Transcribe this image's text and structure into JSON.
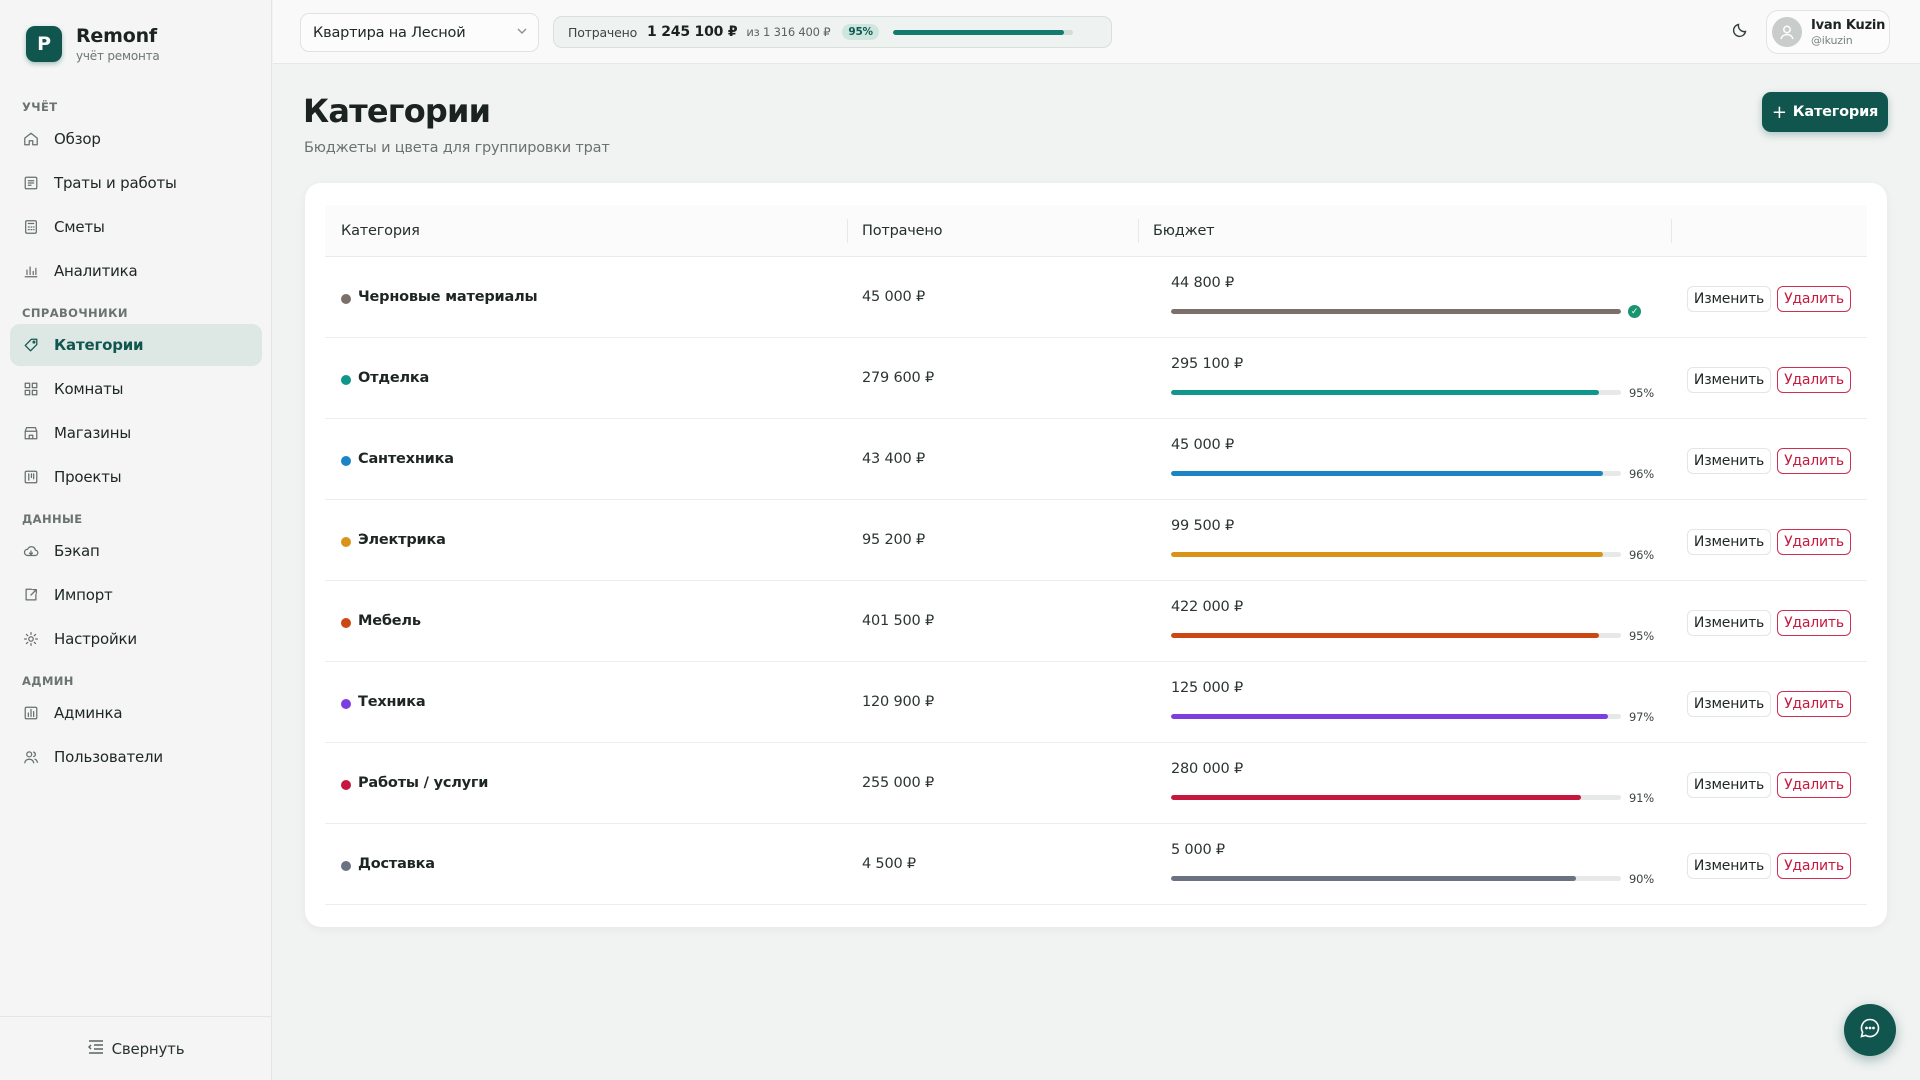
{
  "brand": {
    "logo_letter": "P",
    "name": "Remonf",
    "subtitle": "учёт ремонта"
  },
  "sidebar": {
    "sections": [
      {
        "title": "УЧЁТ",
        "items": [
          {
            "label": "Обзор",
            "icon": "home-icon"
          },
          {
            "label": "Траты и работы",
            "icon": "receipt-icon"
          },
          {
            "label": "Сметы",
            "icon": "calculator-icon"
          },
          {
            "label": "Аналитика",
            "icon": "bar-chart-icon"
          }
        ]
      },
      {
        "title": "СПРАВОЧНИКИ",
        "items": [
          {
            "label": "Категории",
            "icon": "tag-icon",
            "active": true
          },
          {
            "label": "Комнаты",
            "icon": "grid-icon"
          },
          {
            "label": "Магазины",
            "icon": "store-icon"
          },
          {
            "label": "Проекты",
            "icon": "board-icon"
          }
        ]
      },
      {
        "title": "ДАННЫЕ",
        "items": [
          {
            "label": "Бэкап",
            "icon": "cloud-icon"
          },
          {
            "label": "Импорт",
            "icon": "import-icon"
          },
          {
            "label": "Настройки",
            "icon": "gear-icon"
          }
        ]
      },
      {
        "title": "АДМИН",
        "items": [
          {
            "label": "Админка",
            "icon": "admin-panel-icon"
          },
          {
            "label": "Пользователи",
            "icon": "users-icon"
          }
        ]
      }
    ],
    "collapse_label": "Свернуть"
  },
  "topbar": {
    "project": "Квартира на Лесной",
    "spend": {
      "label": "Потрачено",
      "amount": "1 245 100 ₽",
      "of": "из 1 316 400 ₽",
      "percent_label": "95%",
      "progress": 0.95
    },
    "user": {
      "name": "Ivan Kuzin",
      "handle": "@ikuzin"
    }
  },
  "page": {
    "title": "Категории",
    "subtitle": "Бюджеты и цвета для группировки трат",
    "add_button": "Категория"
  },
  "table": {
    "headers": {
      "name": "Категория",
      "spent": "Потрачено",
      "budget": "Бюджет"
    },
    "edit_label": "Изменить",
    "delete_label": "Удалить",
    "rows": [
      {
        "name": "Черновые материалы",
        "spent": "45 000 ₽",
        "budget": "44 800 ₽",
        "progress": 1.0,
        "pct": "",
        "over": true,
        "color": "#7b6f69"
      },
      {
        "name": "Отделка",
        "spent": "279 600 ₽",
        "budget": "295 100 ₽",
        "progress": 0.95,
        "pct": "95%",
        "over": false,
        "color": "#10968a"
      },
      {
        "name": "Сантехника",
        "spent": "43 400 ₽",
        "budget": "45 000 ₽",
        "progress": 0.96,
        "pct": "96%",
        "over": false,
        "color": "#1a84c7"
      },
      {
        "name": "Электрика",
        "spent": "95 200 ₽",
        "budget": "99 500 ₽",
        "progress": 0.96,
        "pct": "96%",
        "over": false,
        "color": "#d99418"
      },
      {
        "name": "Мебель",
        "spent": "401 500 ₽",
        "budget": "422 000 ₽",
        "progress": 0.95,
        "pct": "95%",
        "over": false,
        "color": "#cc4712"
      },
      {
        "name": "Техника",
        "spent": "120 900 ₽",
        "budget": "125 000 ₽",
        "progress": 0.97,
        "pct": "97%",
        "over": false,
        "color": "#7d3ee0"
      },
      {
        "name": "Работы / услуги",
        "spent": "255 000 ₽",
        "budget": "280 000 ₽",
        "progress": 0.91,
        "pct": "91%",
        "over": false,
        "color": "#c4183f"
      },
      {
        "name": "Доставка",
        "spent": "4 500 ₽",
        "budget": "5 000 ₽",
        "progress": 0.9,
        "pct": "90%",
        "over": false,
        "color": "#6b7382"
      }
    ]
  },
  "colors": {
    "accent": "#10564e",
    "danger": "#c5193e",
    "active_nav_bg": "#dde7e4"
  },
  "icons": {
    "theme": "moon-icon",
    "chat": "chat-icon",
    "ok": "check-circle-icon",
    "avatar": "user-avatar-icon",
    "collapse": "collapse-list-icon",
    "dropdown": "chevron-down-icon",
    "plus": "plus-icon"
  }
}
